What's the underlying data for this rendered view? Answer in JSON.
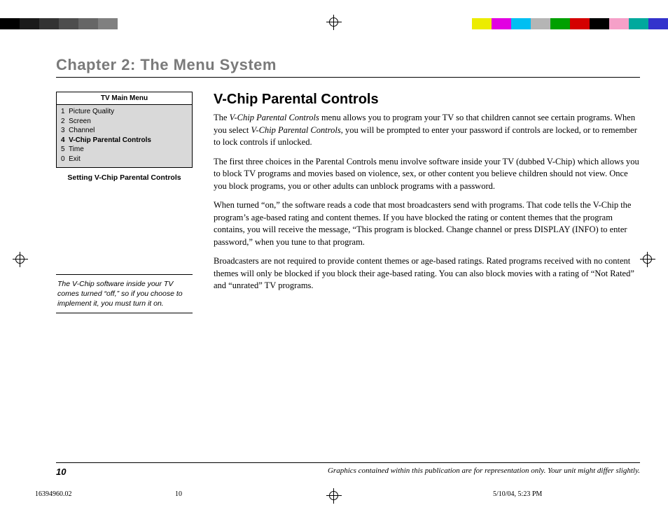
{
  "colorbar": {
    "left": [
      "#000000",
      "#1a1a1a",
      "#333333",
      "#4d4d4d",
      "#666666",
      "#808080"
    ],
    "right": [
      "#ecec00",
      "#e200e2",
      "#00bff2",
      "#b5b5b5",
      "#00a000",
      "#d40000",
      "#000000",
      "#f5a0c8",
      "#00a99d",
      "#3333cc"
    ]
  },
  "chapter_title": "Chapter 2: The Menu System",
  "sidebar": {
    "menu_title": "TV Main Menu",
    "items": [
      {
        "num": "1",
        "label": "Picture Quality",
        "selected": false
      },
      {
        "num": "2",
        "label": "Screen",
        "selected": false
      },
      {
        "num": "3",
        "label": "Channel",
        "selected": false
      },
      {
        "num": "4",
        "label": "V-Chip Parental Controls",
        "selected": true
      },
      {
        "num": "5",
        "label": "Time",
        "selected": false
      },
      {
        "num": "0",
        "label": "Exit",
        "selected": false
      }
    ],
    "caption": "Setting V-Chip Parental Controls",
    "note": "The V-Chip software inside your TV comes turned “off,” so if you choose to implement it, you must turn it on."
  },
  "content": {
    "heading": "V-Chip Parental Controls",
    "p1_a": "The ",
    "p1_i": "V-Chip Parental Controls",
    "p1_b": " menu allows you to program your TV so that children cannot see certain programs. When you select ",
    "p1_i2": "V-Chip Parental Controls",
    "p1_c": ", you will be prompted to enter your password if controls are locked, or to remember to lock controls if unlocked.",
    "p2": "The first three choices in the Parental Controls menu involve software inside your TV (dubbed V-Chip) which allows you to block TV programs and movies based on violence, sex, or other content you believe children should not view. Once you block programs, you or other adults can unblock programs with a password.",
    "p3": "When turned “on,” the software reads a code that most broadcasters send with programs. That code tells the V-Chip the program’s age-based rating and content themes. If you have blocked the rating or content themes that the program contains, you will receive the message, “This program is blocked. Change channel or press DISPLAY (INFO) to enter password,” when you tune to that program.",
    "p4": "Broadcasters are not required to provide content themes or age-based ratings. Rated programs received with no content themes will only be blocked if you block their age-based rating. You can also block movies with a rating of “Not Rated” and “unrated” TV programs."
  },
  "footer": {
    "page_num": "10",
    "note": "Graphics contained within this publication are for representation only. Your unit might differ slightly."
  },
  "slug": {
    "doc_id": "16394960.02",
    "page": "10",
    "datetime": "5/10/04, 5:23 PM"
  }
}
